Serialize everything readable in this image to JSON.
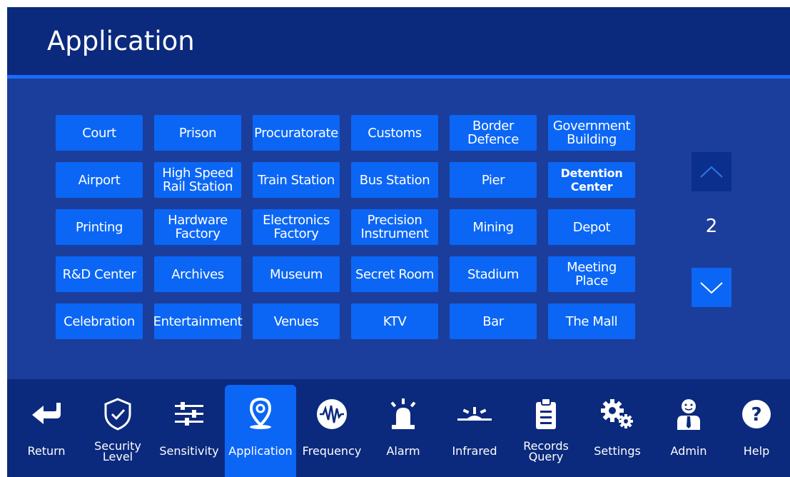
{
  "header": {
    "title": "Application"
  },
  "grid": {
    "rows": [
      [
        "Court",
        "Prison",
        "Procuratorate",
        "Customs",
        "Border\nDefence",
        "Government\nBuilding"
      ],
      [
        "Airport",
        "High Speed\nRail Station",
        "Train Station",
        "Bus Station",
        "Pier",
        "Detention\nCenter"
      ],
      [
        "Printing",
        "Hardware\nFactory",
        "Electronics\nFactory",
        "Precision\nInstrument",
        "Mining",
        "Depot"
      ],
      [
        "R&D Center",
        "Archives",
        "Museum",
        "Secret Room",
        "Stadium",
        "Meeting\nPlace"
      ],
      [
        "Celebration",
        "Entertainment",
        "Venues",
        "KTV",
        "Bar",
        "The Mall"
      ]
    ]
  },
  "pager": {
    "page": "2",
    "up_icon": "chevron-up-icon",
    "down_icon": "chevron-down-icon"
  },
  "nav": {
    "active": "Application",
    "items": [
      {
        "label": "Return",
        "icon": "return-arrow-icon"
      },
      {
        "label": "Security\nLevel",
        "icon": "shield-check-icon"
      },
      {
        "label": "Sensitivity",
        "icon": "sliders-icon"
      },
      {
        "label": "Application",
        "icon": "location-pin-icon"
      },
      {
        "label": "Frequency",
        "icon": "waveform-icon"
      },
      {
        "label": "Alarm",
        "icon": "alarm-light-icon"
      },
      {
        "label": "Infrared",
        "icon": "infrared-icon"
      },
      {
        "label": "Records\nQuery",
        "icon": "clipboard-icon"
      },
      {
        "label": "Settings",
        "icon": "gears-icon"
      },
      {
        "label": "Admin",
        "icon": "admin-user-icon"
      },
      {
        "label": "Help",
        "icon": "help-icon"
      }
    ]
  },
  "colors": {
    "background": "#1b3e9c",
    "header": "#0b2a7d",
    "tile": "#0b66f5",
    "accent_line": "#1b6bff"
  }
}
